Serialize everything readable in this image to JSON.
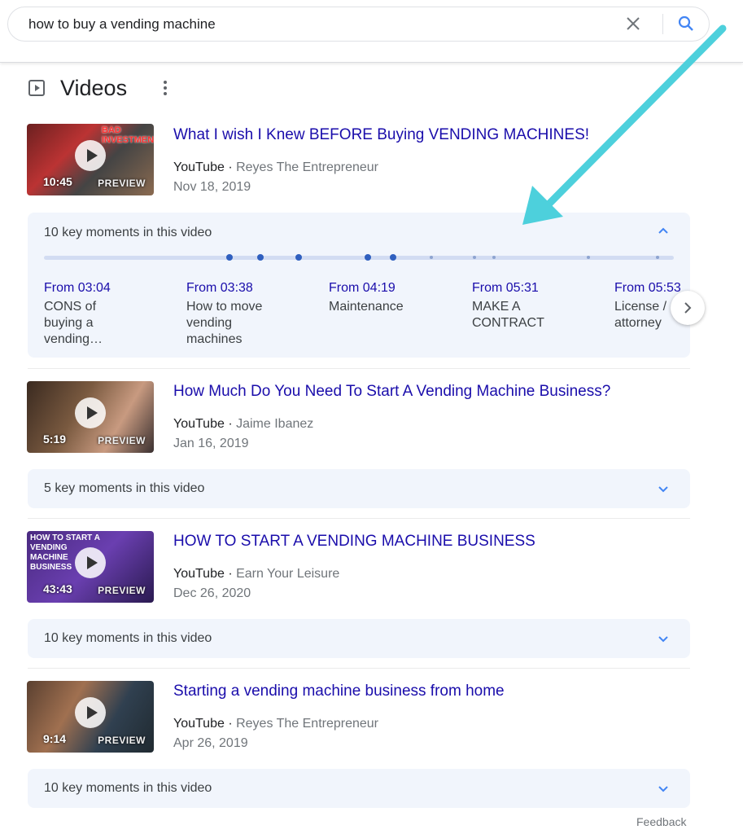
{
  "search": {
    "query": "how to buy a vending machine"
  },
  "section": {
    "title": "Videos"
  },
  "videos": [
    {
      "title": "What I wish I Knew BEFORE Buying VENDING MACHINES!",
      "source": "YouTube",
      "channel": "Reyes The Entrepreneur",
      "date": "Nov 18, 2019",
      "duration": "10:45",
      "preview": "PREVIEW",
      "thumb_text": "BAD INVESTMENT!",
      "key_moments": "10 key moments in this video"
    },
    {
      "title": "How Much Do You Need To Start A Vending Machine Business?",
      "source": "YouTube",
      "channel": "Jaime Ibanez",
      "date": "Jan 16, 2019",
      "duration": "5:19",
      "preview": "PREVIEW",
      "key_moments": "5 key moments in this video"
    },
    {
      "title": "HOW TO START A VENDING MACHINE BUSINESS",
      "source": "YouTube",
      "channel": "Earn Your Leisure",
      "date": "Dec 26, 2020",
      "duration": "43:43",
      "preview": "PREVIEW",
      "thumb_text": "HOW TO START A VENDING MACHINE BUSINESS",
      "key_moments": "10 key moments in this video"
    },
    {
      "title": "Starting a vending machine business from home",
      "source": "YouTube",
      "channel": "Reyes The Entrepreneur",
      "date": "Apr 26, 2019",
      "duration": "9:14",
      "preview": "PREVIEW",
      "key_moments": "10 key moments in this video"
    }
  ],
  "moments": [
    {
      "time": "From 03:04",
      "label": "CONS of buying a vending…"
    },
    {
      "time": "From 03:38",
      "label": "How to move vending machines"
    },
    {
      "time": "From 04:19",
      "label": "Maintenance"
    },
    {
      "time": "From 05:31",
      "label": "MAKE A CONTRACT"
    },
    {
      "time": "From 05:53",
      "label": "License / attorney"
    }
  ],
  "footer": {
    "feedback": "Feedback"
  },
  "colors": {
    "link": "#1a0dab",
    "accent_arrow": "#4dd0dc",
    "keymoment_bg": "#f1f5fc"
  }
}
